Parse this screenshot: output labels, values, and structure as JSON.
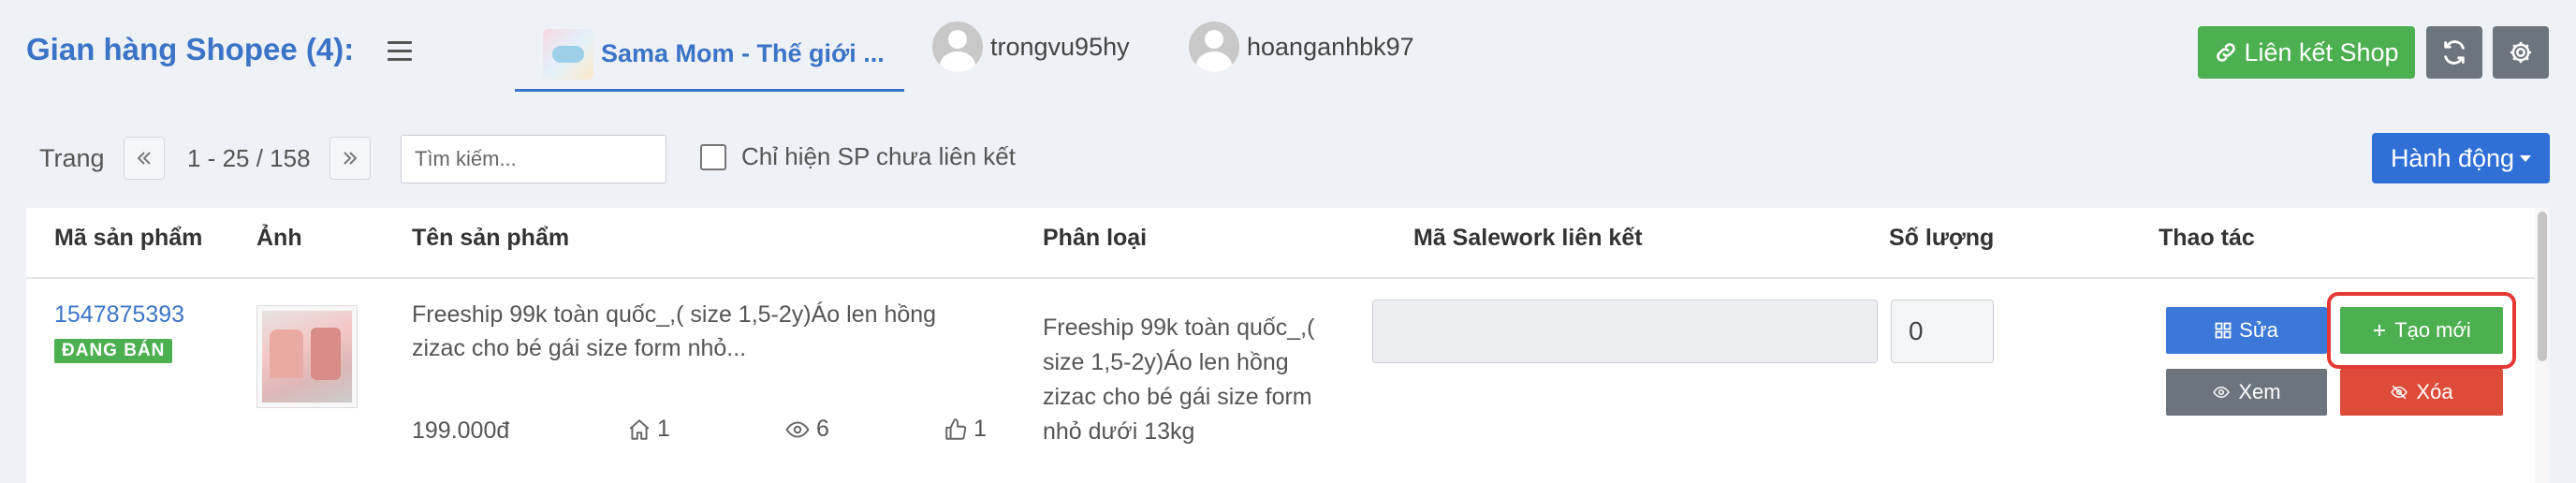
{
  "header": {
    "title": "Gian hàng Shopee (4):",
    "shops": [
      {
        "name": "Sama Mom - Thế giới ...",
        "active": true
      },
      {
        "name": "trongvu95hy",
        "active": false
      },
      {
        "name": "hoanganhbk97",
        "active": false
      }
    ],
    "link_shop_label": "Liên kết Shop"
  },
  "toolbar": {
    "page_label": "Trang",
    "page_range": "1 - 25 / 158",
    "search_placeholder": "Tìm kiếm...",
    "unlinked_only_label": "Chỉ hiện SP chưa liên kết",
    "action_label": "Hành động"
  },
  "table": {
    "columns": [
      "Mã sản phẩm",
      "Ảnh",
      "Tên sản phẩm",
      "Phân loại",
      "Mã Salework liên kết",
      "Số lượng",
      "Thao tác"
    ],
    "rows": [
      {
        "sku": "1547875393",
        "status": "ĐANG BÁN",
        "name": "Freeship 99k toàn quốc_,( size 1,5-2y)Áo len hồng zizac cho bé gái size form nhỏ...",
        "price": "199.000đ",
        "stock_count": "1",
        "views": "6",
        "likes": "1",
        "variant": "Freeship 99k toàn quốc_,( size 1,5-2y)Áo len hồng zizac cho bé gái size form nhỏ dưới 13kg",
        "linked_code": "",
        "quantity": "0",
        "actions": {
          "edit": "Sửa",
          "create": "Tạo mới",
          "view": "Xem",
          "delete": "Xóa"
        }
      }
    ]
  },
  "colors": {
    "brand_blue": "#3b74c7",
    "success_green": "#4caf50",
    "danger_red": "#dd4b39",
    "secondary_gray": "#6c757d",
    "highlight_ring": "#e53935"
  }
}
